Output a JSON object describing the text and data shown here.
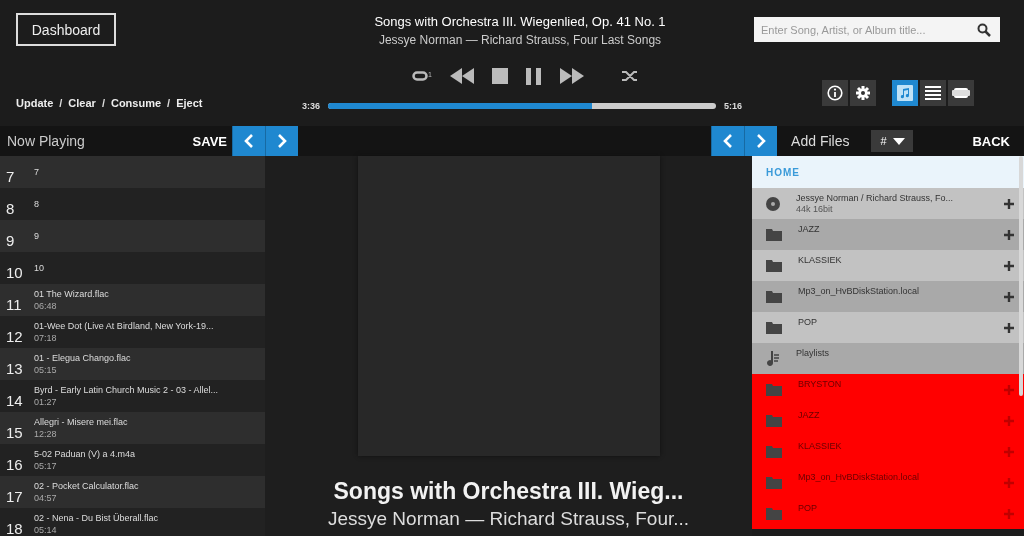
{
  "header": {
    "dashboard": "Dashboard",
    "actions": [
      "Update",
      "Clear",
      "Consume",
      "Eject"
    ],
    "separator": "/",
    "song_title": "Songs with Orchestra III. Wiegenlied, Op. 41 No. 1",
    "song_subtitle": "Jessye Norman — Richard Strauss, Four Last Songs",
    "repeat_badge": "1",
    "elapsed": "3:36",
    "total": "5:16",
    "level": 0.68,
    "search": {
      "placeholder": "Enter Song, Artist, or Album title..."
    },
    "views": [
      {
        "kind": "music",
        "selected": true
      },
      {
        "kind": "list",
        "selected": false
      },
      {
        "kind": "card",
        "selected": false
      }
    ]
  },
  "queue": {
    "title": "Now Playing",
    "save": "SAVE",
    "items": [
      {
        "number": "7",
        "title": "7"
      },
      {
        "number": "8",
        "title": "8"
      },
      {
        "number": "9",
        "title": "9"
      },
      {
        "number": "10",
        "title": "10"
      },
      {
        "number": "11",
        "title": "01 The Wizard.flac",
        "duration": "06:48"
      },
      {
        "number": "12",
        "title": "01-Wee Dot (Live At Birdland, New York-19...",
        "duration": "07:18"
      },
      {
        "number": "13",
        "title": "01 - Elegua Chango.flac",
        "duration": "05:15"
      },
      {
        "number": "14",
        "title": "Byrd - Early Latin Church Music 2 - 03 - Allel...",
        "duration": "01:27"
      },
      {
        "number": "15",
        "title": "Allegri - Misere mei.flac",
        "duration": "12:28"
      },
      {
        "number": "16",
        "title": "5-02 Paduan (V) a 4.m4a",
        "duration": "05:17"
      },
      {
        "number": "17",
        "title": "02 - Pocket Calculator.flac",
        "duration": "04:57"
      },
      {
        "number": "18",
        "title": "02 - Nena - Du Bist Überall.flac",
        "duration": "05:14"
      }
    ]
  },
  "now_playing": {
    "title": "Songs with Orchestra III. Wieg...",
    "subtitle": "Jessye Norman — Richard Strauss, Four..."
  },
  "browser": {
    "title": "Add Files",
    "sort": "#",
    "back": "BACK",
    "home": "HOME",
    "items": [
      {
        "kind": "album",
        "name": "Jessye Norman / Richard Strauss, Fo...",
        "detail": "44k 16bit",
        "addable": true,
        "marked": false
      },
      {
        "kind": "folder",
        "name": "JAZZ",
        "addable": true,
        "marked": false
      },
      {
        "kind": "folder",
        "name": "KLASSIEK",
        "addable": true,
        "marked": false
      },
      {
        "kind": "folder",
        "name": "Mp3_on_HvBDiskStation.local",
        "addable": true,
        "marked": false
      },
      {
        "kind": "folder",
        "name": "POP",
        "addable": true,
        "marked": false
      },
      {
        "kind": "playlist",
        "name": "Playlists",
        "addable": false,
        "marked": false
      },
      {
        "kind": "folder",
        "name": "BRYSTON",
        "addable": true,
        "marked": true
      },
      {
        "kind": "folder",
        "name": "JAZZ",
        "addable": true,
        "marked": true
      },
      {
        "kind": "folder",
        "name": "KLASSIEK",
        "addable": true,
        "marked": true
      },
      {
        "kind": "folder",
        "name": "Mp3_on_HvBDiskStation.local",
        "addable": true,
        "marked": true
      },
      {
        "kind": "folder",
        "name": "POP",
        "addable": true,
        "marked": true
      }
    ]
  }
}
